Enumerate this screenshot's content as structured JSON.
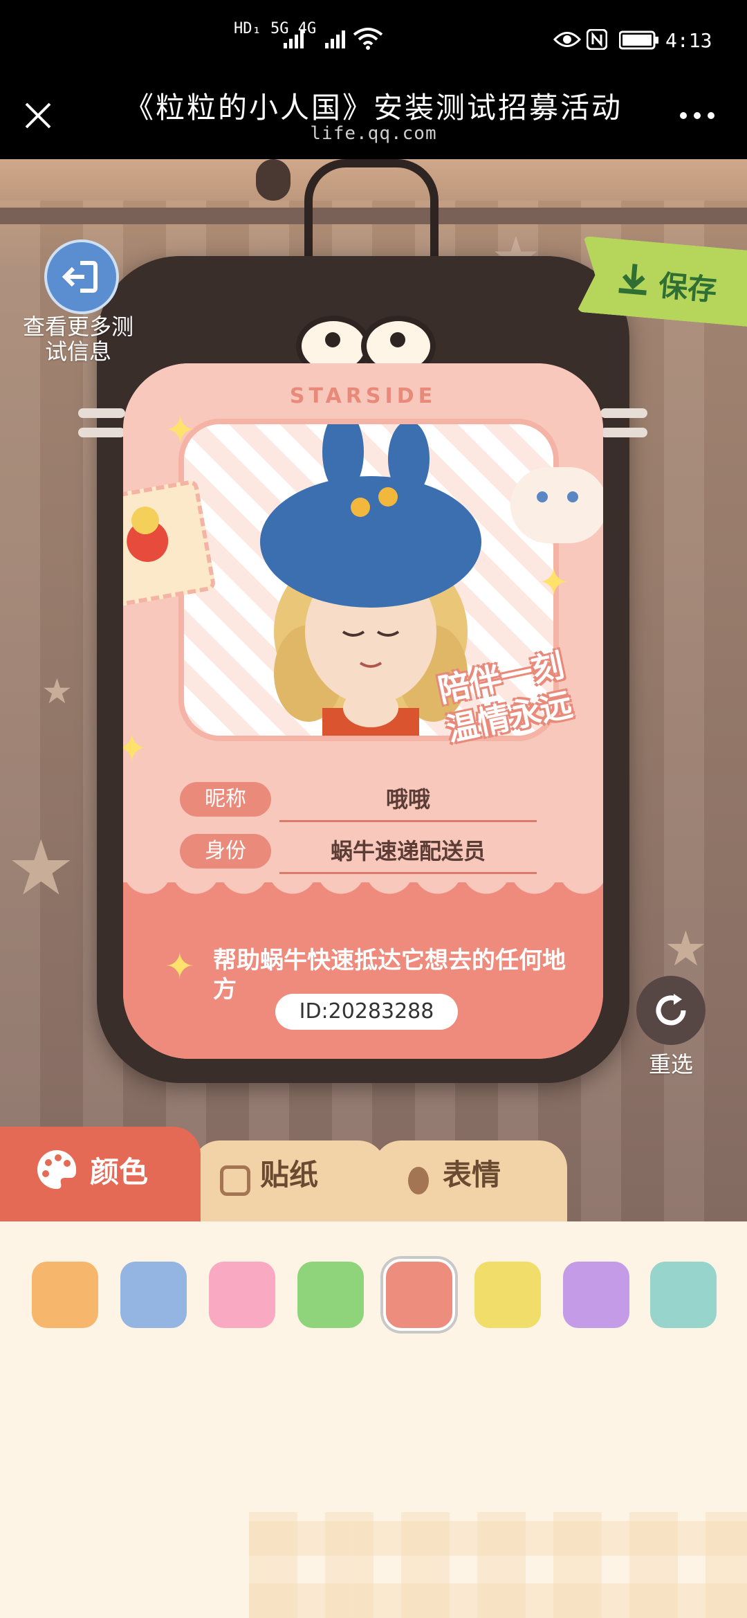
{
  "status_bar": {
    "network_label": "HD₁ 5G 4G",
    "time": "4:13"
  },
  "title_bar": {
    "title": "《粒粒的小人国》安装测试招募活动",
    "url": "life.qq.com"
  },
  "side": {
    "more_info_label": "查看更多测试信息",
    "save_label": "保存",
    "reselect_label": "重选"
  },
  "card": {
    "brand": "STARSIDE",
    "slogan": "陪伴一刻 温情永远",
    "nickname_label": "昵称",
    "nickname_value": "哦哦",
    "identity_label": "身份",
    "identity_value": "蜗牛速递配送员",
    "description": "帮助蜗牛快速抵达它想去的任何地方",
    "id": "ID:20283288"
  },
  "tabs": [
    {
      "label": "颜色"
    },
    {
      "label": "贴纸"
    },
    {
      "label": "表情"
    }
  ],
  "palette": {
    "colors": [
      "#f6b76c",
      "#94b5e1",
      "#f9aac2",
      "#8fd47a",
      "#ec8d7d",
      "#f0dd6a",
      "#c39be6",
      "#97d4cb"
    ],
    "selected_index": 4
  }
}
